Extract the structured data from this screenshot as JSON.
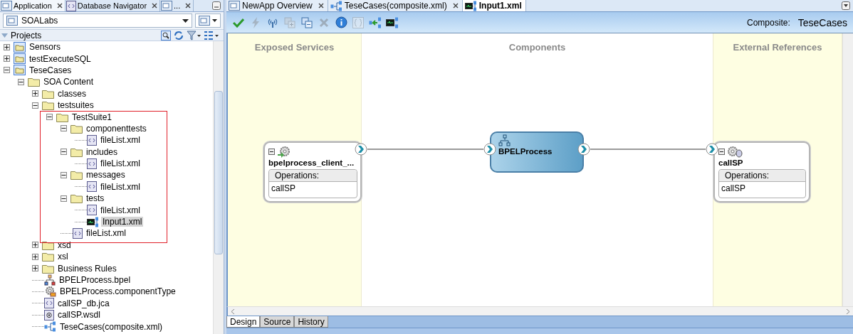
{
  "left_tabs": [
    {
      "label": "Application",
      "selected": true
    },
    {
      "label": "Database Navigator",
      "selected": false
    },
    {
      "label": "...",
      "selected": false
    }
  ],
  "application_selector": {
    "value": "SOALabs"
  },
  "projects_header": {
    "title": "Projects"
  },
  "tree": [
    {
      "kind": "project",
      "label": "Sensors",
      "expanded": false,
      "selected": false
    },
    {
      "kind": "project",
      "label": "testExecuteSQL",
      "expanded": false,
      "selected": false
    },
    {
      "kind": "project",
      "label": "TeseCases",
      "expanded": true,
      "selected": false,
      "children": [
        {
          "kind": "folder",
          "label": "SOA Content",
          "expanded": true,
          "selected": false,
          "children": [
            {
              "kind": "folder",
              "label": "classes",
              "expanded": false,
              "selected": false
            },
            {
              "kind": "folder",
              "label": "testsuites",
              "expanded": true,
              "selected": false,
              "children": [
                {
                  "kind": "folder",
                  "label": "TestSuite1",
                  "expanded": true,
                  "selected": false,
                  "children": [
                    {
                      "kind": "folder",
                      "label": "componenttests",
                      "expanded": true,
                      "selected": false,
                      "children": [
                        {
                          "kind": "xml",
                          "label": "fileList.xml",
                          "selected": false
                        }
                      ]
                    },
                    {
                      "kind": "folder",
                      "label": "includes",
                      "expanded": true,
                      "selected": false,
                      "children": [
                        {
                          "kind": "xml",
                          "label": "fileList.xml",
                          "selected": false
                        }
                      ]
                    },
                    {
                      "kind": "folder",
                      "label": "messages",
                      "expanded": true,
                      "selected": false,
                      "children": [
                        {
                          "kind": "xml",
                          "label": "fileList.xml",
                          "selected": false
                        }
                      ]
                    },
                    {
                      "kind": "folder",
                      "label": "tests",
                      "expanded": true,
                      "selected": false,
                      "children": [
                        {
                          "kind": "xml",
                          "label": "fileList.xml",
                          "selected": false
                        },
                        {
                          "kind": "test",
                          "label": "Input1.xml",
                          "selected": true
                        }
                      ]
                    },
                    {
                      "kind": "xml",
                      "label": "fileList.xml",
                      "selected": false
                    }
                  ]
                }
              ]
            },
            {
              "kind": "folder",
              "label": "xsd",
              "expanded": false,
              "selected": false
            },
            {
              "kind": "folder",
              "label": "xsl",
              "expanded": false,
              "selected": false
            },
            {
              "kind": "folder",
              "label": "Business Rules",
              "expanded": false,
              "selected": false
            },
            {
              "kind": "bpel",
              "label": "BPELProcess.bpel",
              "selected": false
            },
            {
              "kind": "component",
              "label": "BPELProcess.componentType",
              "selected": false
            },
            {
              "kind": "xml",
              "label": "callSP_db.jca",
              "selected": false
            },
            {
              "kind": "wsdl",
              "label": "callSP.wsdl",
              "selected": false
            },
            {
              "kind": "composite",
              "label": "TeseCases(composite.xml)",
              "selected": false
            }
          ]
        }
      ]
    }
  ],
  "editor_tabs": [
    {
      "label": "NewApp Overview",
      "selected": false
    },
    {
      "label": "TeseCases(composite.xml)",
      "selected": false
    },
    {
      "label": "Input1.xml",
      "selected": true
    }
  ],
  "toolbar": [
    {
      "disabled": false
    },
    {
      "disabled": true
    },
    {
      "disabled": false
    },
    {
      "disabled": true
    },
    {
      "disabled": false
    },
    {
      "disabled": true
    },
    {
      "disabled": false
    },
    {
      "disabled": true
    },
    {
      "disabled": false
    },
    {
      "disabled": false
    }
  ],
  "composite": {
    "label": "Composite:",
    "name": "TeseCases"
  },
  "lanes": [
    {
      "title": "Exposed Services",
      "kind": "side"
    },
    {
      "title": "Components",
      "kind": "middle"
    },
    {
      "title": "External References",
      "kind": "side"
    }
  ],
  "service": {
    "name": "bpelprocess_client_...",
    "operations_label": "Operations:",
    "operations": [
      "callSP"
    ]
  },
  "component": {
    "name": "BPELProcess"
  },
  "reference": {
    "name": "callSP",
    "operations_label": "Operations:",
    "operations": [
      "callSP"
    ]
  },
  "bottom_tabs": [
    {
      "label": "Design",
      "selected": true
    },
    {
      "label": "Source",
      "selected": false
    },
    {
      "label": "History",
      "selected": false
    }
  ]
}
